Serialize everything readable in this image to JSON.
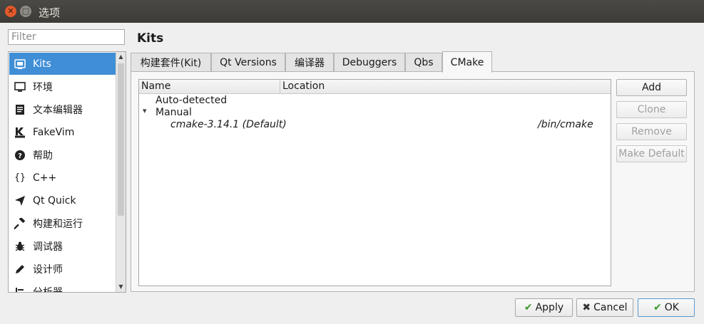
{
  "window": {
    "title": "选项"
  },
  "filter": {
    "placeholder": "Filter"
  },
  "sidebar": {
    "items": [
      {
        "label": "Kits",
        "icon": "kits-icon"
      },
      {
        "label": "环境",
        "icon": "monitor-icon"
      },
      {
        "label": "文本编辑器",
        "icon": "text-editor-icon"
      },
      {
        "label": "FakeVim",
        "icon": "fakevim-icon"
      },
      {
        "label": "帮助",
        "icon": "help-icon"
      },
      {
        "label": "C++",
        "icon": "braces-icon"
      },
      {
        "label": "Qt Quick",
        "icon": "paper-plane-icon"
      },
      {
        "label": "构建和运行",
        "icon": "hammer-icon"
      },
      {
        "label": "调试器",
        "icon": "bug-icon"
      },
      {
        "label": "设计师",
        "icon": "pencil-icon"
      },
      {
        "label": "分析器",
        "icon": "analyzer-icon"
      }
    ]
  },
  "page": {
    "title": "Kits"
  },
  "tabs": [
    {
      "label": "构建套件(Kit)"
    },
    {
      "label": "Qt Versions"
    },
    {
      "label": "编译器"
    },
    {
      "label": "Debuggers"
    },
    {
      "label": "Qbs"
    },
    {
      "label": "CMake"
    }
  ],
  "tree": {
    "columns": [
      "Name",
      "Location"
    ],
    "groups": [
      {
        "label": "Auto-detected"
      },
      {
        "label": "Manual",
        "expand_glyph": "▾"
      }
    ],
    "rows": [
      {
        "name": "cmake-3.14.1 (Default)",
        "location": "/bin/cmake"
      }
    ]
  },
  "side_buttons": {
    "add": "Add",
    "clone": "Clone",
    "remove": "Remove",
    "make_default": "Make Default"
  },
  "dialog_buttons": {
    "apply": "Apply",
    "cancel": "Cancel",
    "ok": "OK"
  },
  "colors": {
    "selection": "#3f8ed6",
    "titlebar": "#3c3b37",
    "close_button": "#e3582a"
  }
}
